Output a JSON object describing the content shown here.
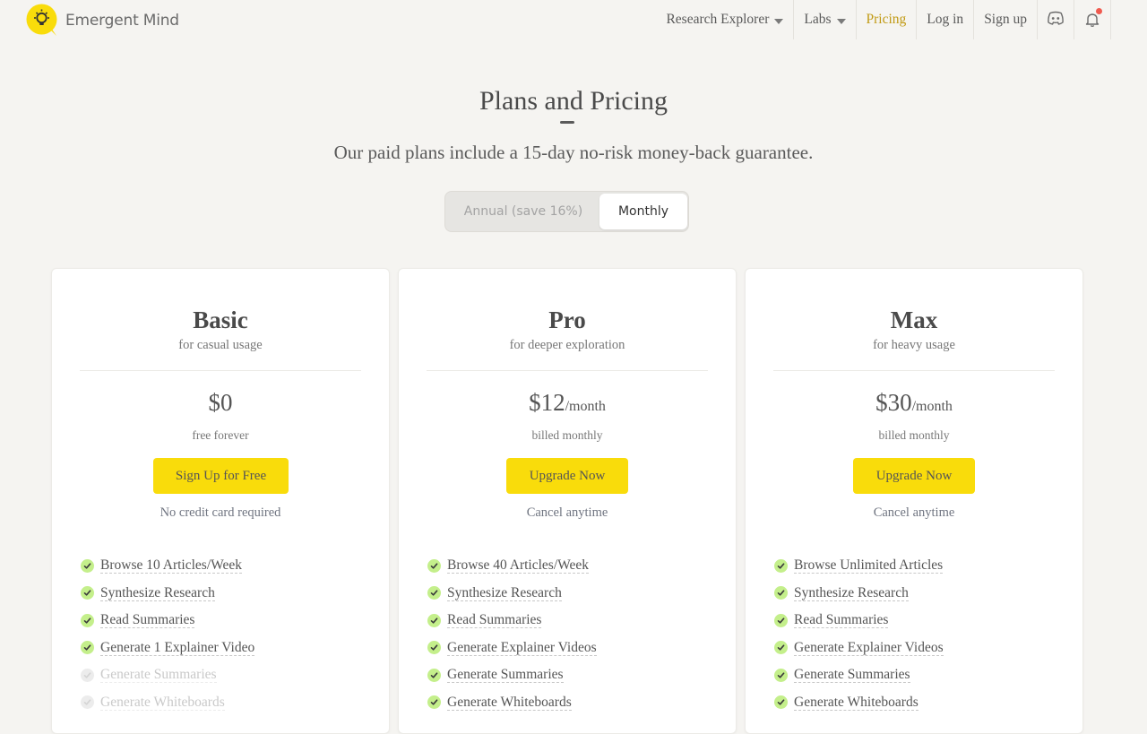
{
  "brand": {
    "name": "Emergent Mind",
    "logo_icon": "lightbulb-icon",
    "accent": "#f9dc0b"
  },
  "nav": {
    "research_explorer": "Research Explorer",
    "labs": "Labs",
    "pricing": "Pricing",
    "login": "Log in",
    "signup": "Sign up",
    "discord_icon": "discord-icon",
    "bell_icon": "bell-icon"
  },
  "hero": {
    "title": "Plans and Pricing",
    "subtitle": "Our paid plans include a 15-day no-risk money-back guarantee."
  },
  "billing_toggle": {
    "annual": "Annual (save 16%)",
    "monthly": "Monthly",
    "selected": "Monthly"
  },
  "plans": [
    {
      "name": "Basic",
      "desc": "for casual usage",
      "price": "$0",
      "period": "",
      "billing": "free forever",
      "cta": "Sign Up for Free",
      "note": "No credit card required",
      "features": [
        {
          "label": "Browse 10 Articles/Week",
          "enabled": true
        },
        {
          "label": "Synthesize Research",
          "enabled": true
        },
        {
          "label": "Read Summaries",
          "enabled": true
        },
        {
          "label": "Generate 1 Explainer Video",
          "enabled": true
        },
        {
          "label": "Generate Summaries",
          "enabled": false
        },
        {
          "label": "Generate Whiteboards",
          "enabled": false
        }
      ]
    },
    {
      "name": "Pro",
      "desc": "for deeper exploration",
      "price": "$12",
      "period": "/month",
      "billing": "billed monthly",
      "cta": "Upgrade Now",
      "note": "Cancel anytime",
      "features": [
        {
          "label": "Browse 40 Articles/Week",
          "enabled": true
        },
        {
          "label": "Synthesize Research",
          "enabled": true
        },
        {
          "label": "Read Summaries",
          "enabled": true
        },
        {
          "label": "Generate Explainer Videos",
          "enabled": true
        },
        {
          "label": "Generate Summaries",
          "enabled": true
        },
        {
          "label": "Generate Whiteboards",
          "enabled": true
        }
      ]
    },
    {
      "name": "Max",
      "desc": "for heavy usage",
      "price": "$30",
      "period": "/month",
      "billing": "billed monthly",
      "cta": "Upgrade Now",
      "note": "Cancel anytime",
      "features": [
        {
          "label": "Browse Unlimited Articles",
          "enabled": true
        },
        {
          "label": "Synthesize Research",
          "enabled": true
        },
        {
          "label": "Read Summaries",
          "enabled": true
        },
        {
          "label": "Generate Explainer Videos",
          "enabled": true
        },
        {
          "label": "Generate Summaries",
          "enabled": true
        },
        {
          "label": "Generate Whiteboards",
          "enabled": true
        }
      ]
    }
  ]
}
